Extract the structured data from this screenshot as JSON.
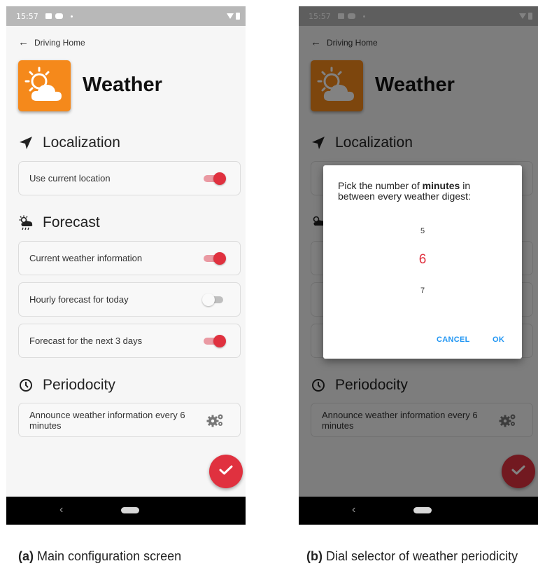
{
  "screens": [
    {
      "status": {
        "time": "15:57"
      },
      "back_label": "Driving Home",
      "title": "Weather",
      "sections": {
        "localization": "Localization",
        "forecast": "Forecast",
        "periodicity": "Periodocity"
      },
      "settings": {
        "use_location": {
          "label": "Use current location",
          "on": true
        },
        "current_weather": {
          "label": "Current weather information",
          "on": true
        },
        "hourly": {
          "label": "Hourly forecast for today",
          "on": false
        },
        "three_days": {
          "label": "Forecast for the next 3 days",
          "on": true
        },
        "announce": {
          "label": "Announce weather information every 6 minutes"
        }
      }
    },
    {
      "status": {
        "time": "15:57"
      },
      "back_label": "Driving Home",
      "title": "Weather",
      "sections": {
        "localization": "Localization",
        "periodicity": "Periodocity"
      },
      "settings": {
        "announce": {
          "label": "Announce weather information every 6 minutes"
        }
      },
      "dialog": {
        "message_prefix": "Pick the number of ",
        "message_bold": "minutes",
        "message_suffix": " in between every weather digest:",
        "dial_values": [
          "5",
          "6",
          "7"
        ],
        "selected": "6",
        "cancel": "CANCEL",
        "ok": "OK"
      }
    }
  ],
  "captions": [
    {
      "tag": "(a)",
      "text": "Main configuration screen"
    },
    {
      "tag": "(b)",
      "text": "Dial selector of weather periodicity"
    }
  ],
  "colors": {
    "accent": "#e0313f",
    "app_icon": "#f5891b",
    "dialog_button": "#2196f3"
  },
  "icons": [
    "back-arrow-icon",
    "weather-app-icon",
    "navigation-arrow-icon",
    "weather-forecast-icon",
    "clock-icon",
    "gears-icon",
    "check-icon"
  ]
}
